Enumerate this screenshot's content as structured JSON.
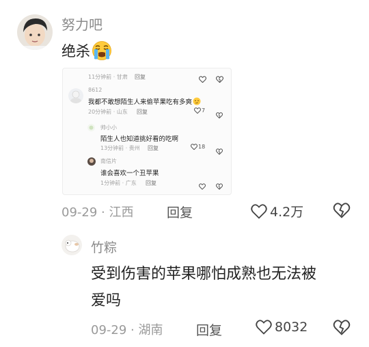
{
  "comment1": {
    "username": "努力吧",
    "text": "绝杀",
    "emoji": "loudly-crying-face-emoji",
    "date_location": "09-29 · 江西",
    "reply_label": "回复",
    "like_count": "4.2万",
    "embed": {
      "top_row": {
        "meta": "11分钟前 · 甘肃",
        "reply": "回复"
      },
      "items": [
        {
          "username": "8612",
          "text": "我都不敢想陌生人来偷苹果吃有多爽",
          "meta": "20分钟前 · 山东",
          "reply": "回复",
          "likes": "7"
        },
        {
          "username": "帅小小",
          "text": "陌生人也知道挑好看的吃啊",
          "meta": "13分钟前 · 贵州",
          "reply": "回复",
          "likes": "18"
        },
        {
          "username": "南信片",
          "text": "谁会喜欢一个丑苹果",
          "meta": "1分钟前 · 广东",
          "reply": "回复"
        }
      ]
    }
  },
  "comment2": {
    "username": "竹粽",
    "text_line1": "受到伤害的苹果哪怕成熟也无法被",
    "text_line2": "爱吗",
    "date_location": "09-29 · 湖南",
    "reply_label": "回复",
    "like_count": "8032"
  },
  "colors": {
    "meta_gray": "#9a9a9a",
    "text_dark": "#222222",
    "icon_gray": "#555555"
  }
}
